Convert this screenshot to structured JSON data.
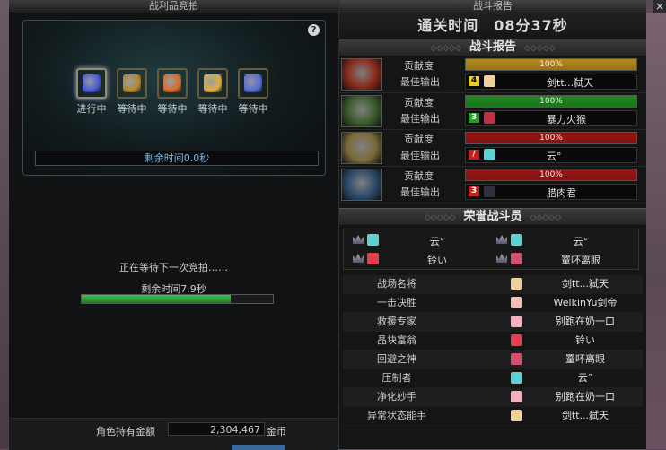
{
  "loot_panel": {
    "title": "战利品竞拍",
    "help": "?",
    "items": [
      {
        "status": "进行中",
        "color": "#4a5ad8",
        "active": true
      },
      {
        "status": "等待中",
        "color": "#b8862a"
      },
      {
        "status": "等待中",
        "color": "#d86a2a"
      },
      {
        "status": "等待中",
        "color": "#e0b040"
      },
      {
        "status": "等待中",
        "color": "#5a6ad8"
      }
    ],
    "remaining_time": "剩余时间0.0秒",
    "waiting_text": "正在等待下一次竞拍……",
    "next_remaining": "剩余时间7.9秒",
    "progress": 0.78,
    "gold_label": "角色持有金额",
    "gold_value": "2,304,467",
    "gold_unit": "金币"
  },
  "report_panel": {
    "title": "战斗报告",
    "close": "×",
    "clear_time": "通关时间　08分37秒",
    "section_battle": "战斗报告",
    "section_honor": "荣誉战斗员",
    "contribution_label": "贡献度",
    "best_output_label": "最佳输出",
    "players": [
      {
        "contribution": "100%",
        "bar_color": "#b48a1a",
        "rank": "4",
        "rank_color": "#e8d020",
        "rank_text_color": "#000",
        "avatar_color": "#f0d0a0",
        "name": "剑tt...弑天",
        "portrait_color": "#8a2a1a"
      },
      {
        "contribution": "100%",
        "bar_color": "#1e8a1e",
        "rank": "3",
        "rank_color": "#2a9a2a",
        "rank_text_color": "#fff",
        "avatar_color": "#c03040",
        "name": "暴力火猴",
        "portrait_color": "#3a5a2a"
      },
      {
        "contribution": "100%",
        "bar_color": "#9a1414",
        "rank": "/",
        "rank_color": "#c02020",
        "rank_text_color": "#fff",
        "avatar_color": "#60d0d0",
        "name": "云°",
        "portrait_color": "#7a6a3a"
      },
      {
        "contribution": "100%",
        "bar_color": "#9a1414",
        "rank": "3",
        "rank_color": "#c02020",
        "rank_text_color": "#fff",
        "avatar_color": "#303040",
        "name": "腊肉君",
        "portrait_color": "#2a4a6a"
      }
    ],
    "honor": [
      {
        "name": "云°",
        "avatar_color": "#60d0d0"
      },
      {
        "name": "云°",
        "avatar_color": "#60d0d0"
      },
      {
        "name": "铃い",
        "avatar_color": "#e04050"
      },
      {
        "name": "罿吥离眼",
        "avatar_color": "#d05070"
      }
    ],
    "titles": [
      {
        "label": "战场名将",
        "name": "剑tt...弑天",
        "avatar_color": "#f0d0a0"
      },
      {
        "label": "一击决胜",
        "name": "WelkinYu剑帝",
        "avatar_color": "#f0c0b0"
      },
      {
        "label": "救援专家",
        "name": "别跑在奶一口",
        "avatar_color": "#f0b0c0"
      },
      {
        "label": "晶块富翁",
        "name": "铃い",
        "avatar_color": "#e04050"
      },
      {
        "label": "回避之神",
        "name": "罿吥离眼",
        "avatar_color": "#d05070"
      },
      {
        "label": "压制者",
        "name": "云°",
        "avatar_color": "#60d0d0"
      },
      {
        "label": "净化妙手",
        "name": "别跑在奶一口",
        "avatar_color": "#f0b0c0"
      },
      {
        "label": "异常状态能手",
        "name": "剑tt...弑天",
        "avatar_color": "#f0d0a0"
      }
    ]
  }
}
